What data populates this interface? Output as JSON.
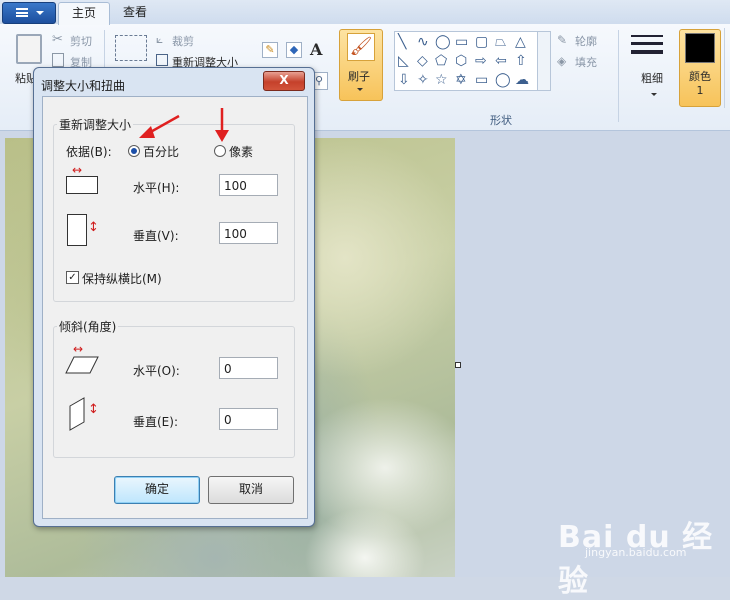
{
  "tabs": {
    "home": "主页",
    "view": "查看"
  },
  "ribbon": {
    "paste": "粘贴",
    "cut": "剪切",
    "copy": "复制",
    "crop": "裁剪",
    "resize": "重新调整大小",
    "brush": "刷子",
    "outline": "轮廓",
    "fill": "填充",
    "shapes_group": "形状",
    "thickness": "粗细",
    "color1": "颜色 1"
  },
  "dialog": {
    "title": "调整大小和扭曲",
    "close": "X",
    "resize_group": "重新调整大小",
    "by_label": "依据(B):",
    "percent": "百分比",
    "pixels": "像素",
    "horizontal_label": "水平(H):",
    "horizontal_value": "100",
    "vertical_label": "垂直(V):",
    "vertical_value": "100",
    "keep_ratio": "保持纵横比(M)",
    "skew_group": "倾斜(角度)",
    "skew_h_label": "水平(O):",
    "skew_h_value": "0",
    "skew_v_label": "垂直(E):",
    "skew_v_value": "0",
    "ok": "确定",
    "cancel": "取消"
  },
  "watermark": {
    "logo": "Bai du 经验",
    "url": "jingyan.baidu.com"
  },
  "colors": {
    "accent": "#1d4f9e",
    "annotation": "#e02020",
    "color1": "#000000",
    "brush_highlight": "#f7c35a"
  }
}
